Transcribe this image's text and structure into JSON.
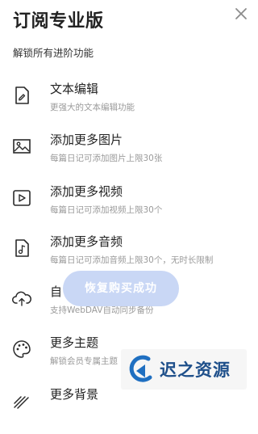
{
  "header": {
    "title": "订阅专业版",
    "subtitle": "解锁所有进阶功能"
  },
  "features": [
    {
      "icon": "edit-note-icon",
      "name": "文本编辑",
      "desc": "更强大的文本编辑功能"
    },
    {
      "icon": "image-icon",
      "name": "添加更多图片",
      "desc": "每篇日记可添加图片上限30张"
    },
    {
      "icon": "video-icon",
      "name": "添加更多视频",
      "desc": "每篇日记可添加视频上限30个"
    },
    {
      "icon": "audio-icon",
      "name": "添加更多音频",
      "desc": "每篇日记可添加音频上限30个，无时长限制"
    },
    {
      "icon": "cloud-upload-icon",
      "name": "自",
      "desc": "支持WebDAV自动同步备份"
    },
    {
      "icon": "palette-icon",
      "name": "更多主题",
      "desc": "解锁会员专属主题"
    },
    {
      "icon": "background-icon",
      "name": "更多背景",
      "desc": ""
    }
  ],
  "toast": {
    "message": "恢复购买成功"
  },
  "watermark": {
    "text": "迟之资源"
  },
  "colors": {
    "toast_bg": "#c4d4f4",
    "watermark_text": "#1e4f8a",
    "desc_text": "#9a9a9a"
  }
}
